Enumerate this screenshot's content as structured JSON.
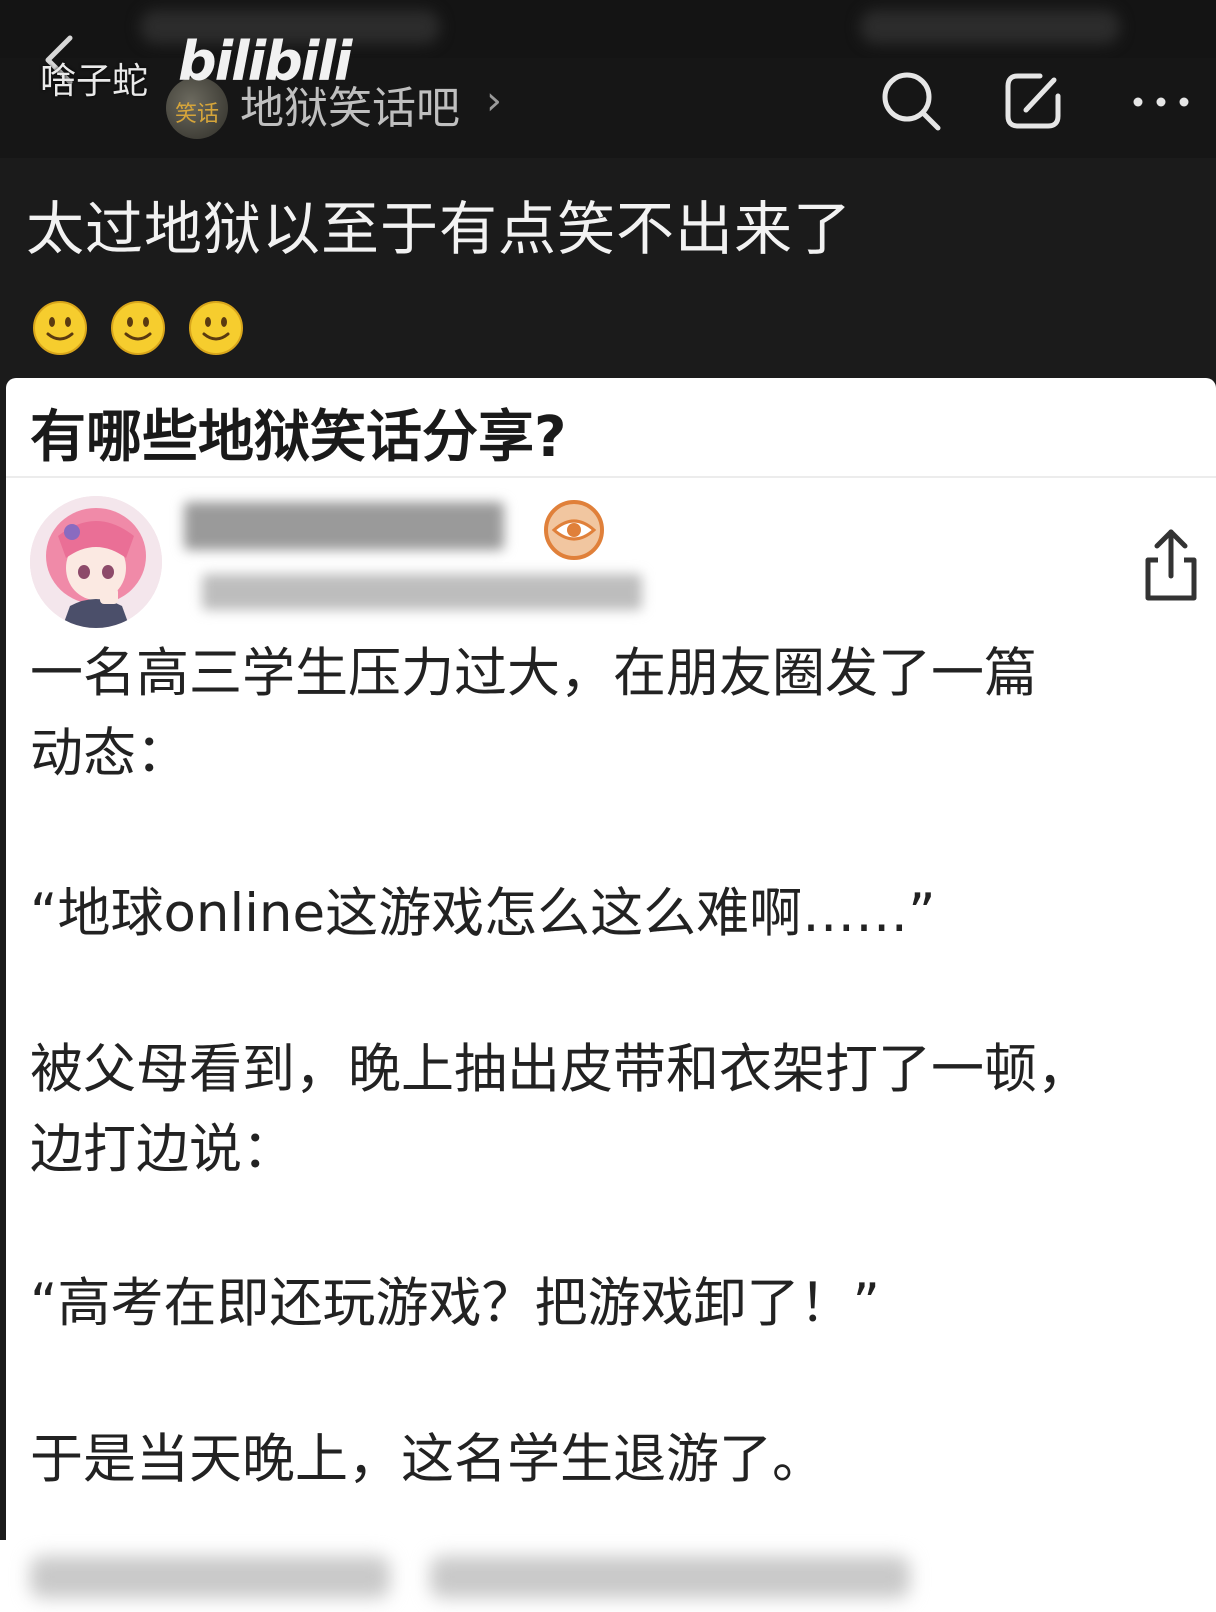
{
  "watermark": {
    "author": "啥子蛇",
    "logo": "bilibili"
  },
  "header": {
    "forum_avatar_label": "笑话",
    "forum_name": "地狱笑话吧",
    "chevron": "›",
    "icons": [
      "back-icon",
      "search-icon",
      "edit-icon",
      "more-icon"
    ]
  },
  "post": {
    "title": "太过地狱以至于有点笑不出来了",
    "emojis": [
      "smiley-icon",
      "smiley-icon",
      "smiley-icon"
    ]
  },
  "card": {
    "question": "有哪些地狱笑话分享?",
    "paragraphs": [
      "一名高三学生压力过大，在朋友圈发了一篇",
      "动态：",
      "“地球online这游戏怎么这么难啊……”",
      "被父母看到，晚上抽出皮带和衣架打了一顿，",
      "边打边说：",
      "“高考在即还玩游戏？把游戏卸了！”",
      "于是当天晚上，这名学生退游了。"
    ]
  },
  "colors": {
    "dark_bg": "#1b1b1b",
    "card_bg": "#ffffff",
    "badge_orange": "#e0803a",
    "emoji_yellow": "#f6cd2e"
  }
}
